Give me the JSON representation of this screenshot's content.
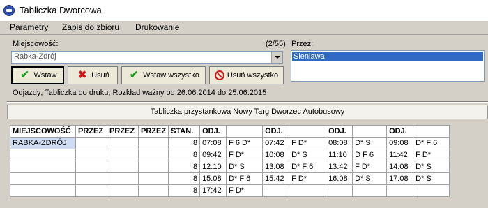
{
  "window": {
    "title": "Tabliczka Dworcowa",
    "icon": "bus-logo-icon"
  },
  "menu": {
    "items": [
      "Parametry",
      "Zapis do zbioru",
      "Drukowanie"
    ]
  },
  "form": {
    "city_label": "Miejscowość:",
    "counter": "(2/55)",
    "city_value": "Rabka-Zdrój",
    "via_label": "Przez:",
    "via_items": [
      "Sieniawa"
    ]
  },
  "buttons": {
    "insert": "Wstaw",
    "delete": "Usuń",
    "insert_all": "Wstaw wszystko",
    "delete_all": "Usuń wszystko"
  },
  "info_line": "Odjazdy; Tabliczka do druku; Rozkład ważny od 26.06.2014 do 25.06.2015",
  "panel_title": "Tabliczka przystankowa Nowy Targ Dworzec Autobusowy",
  "table": {
    "headers": [
      "MIEJSCOWOŚĆ",
      "PRZEZ",
      "PRZEZ",
      "PRZEZ",
      "STAN.",
      "ODJ.",
      "",
      "ODJ.",
      "",
      "ODJ.",
      "",
      "ODJ.",
      ""
    ],
    "rows": [
      [
        "RABKA-ZDRÓJ",
        "",
        "",
        "",
        "8",
        "07:08",
        "F 6 D*",
        "07:42",
        "F D*",
        "08:08",
        "D* S",
        "09:08",
        "D* F 6"
      ],
      [
        "",
        "",
        "",
        "",
        "8",
        "09:42",
        "F D*",
        "10:08",
        "D* S",
        "11:10",
        "D F 6",
        "11:42",
        "F D*"
      ],
      [
        "",
        "",
        "",
        "",
        "8",
        "12:10",
        "D* S",
        "13:08",
        "D* F 6",
        "13:42",
        "F D*",
        "14:08",
        "D* S"
      ],
      [
        "",
        "",
        "",
        "",
        "8",
        "15:08",
        "D* F 6",
        "15:42",
        "F D*",
        "16:08",
        "D* S",
        "17:08",
        "D* S"
      ],
      [
        "",
        "",
        "",
        "",
        "8",
        "17:42",
        "F D*",
        "",
        "",
        "",
        "",
        "",
        ""
      ]
    ]
  }
}
